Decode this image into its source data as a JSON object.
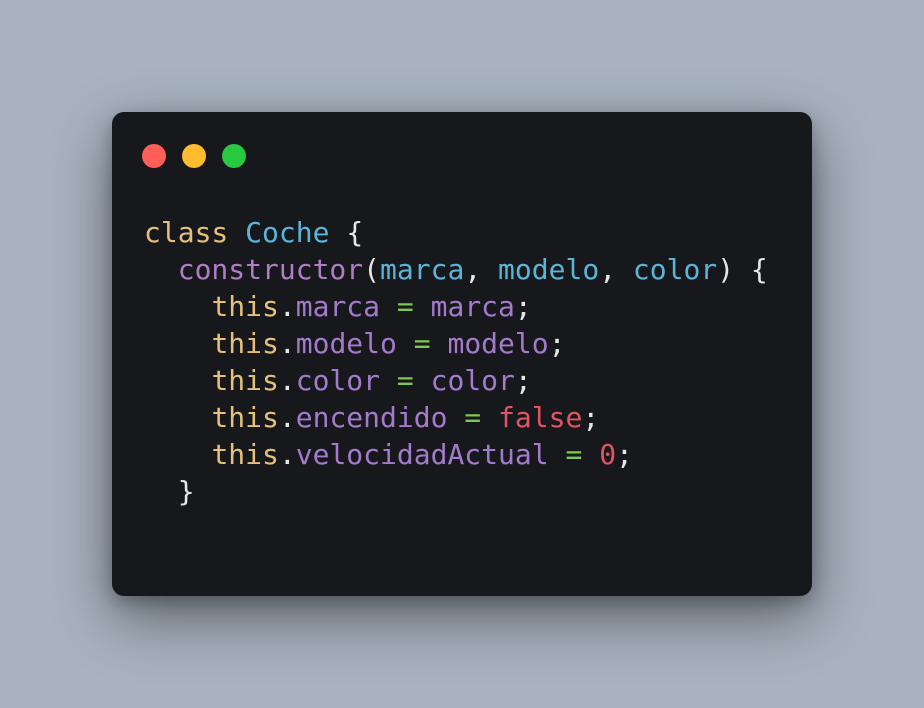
{
  "window": {
    "background": "#17181b",
    "page_background": "#a8b3bf",
    "controls": [
      {
        "name": "close",
        "color": "#ff5f57"
      },
      {
        "name": "minimize",
        "color": "#febc2e"
      },
      {
        "name": "maximize",
        "color": "#28c840"
      }
    ]
  },
  "syntax_colors": {
    "keyword": "#e5c07b",
    "class_name": "#5ab6d9",
    "method": "#b07cc6",
    "param": "#5ab6d9",
    "property": "#a37acc",
    "operator": "#7ec84f",
    "boolean": "#e05561",
    "number": "#e05561",
    "punct": "#e6e6e6"
  },
  "code": {
    "line1": {
      "kw": "class",
      "sp1": " ",
      "name": "Coche",
      "sp2": " ",
      "brace": "{"
    },
    "line2": {
      "indent": "  ",
      "method": "constructor",
      "paren_open": "(",
      "p1": "marca",
      "comma1": ", ",
      "p2": "modelo",
      "comma2": ", ",
      "p3": "color",
      "paren_close": ")",
      "sp": " ",
      "brace": "{"
    },
    "line3": {
      "indent": "    ",
      "this": "this",
      "dot": ".",
      "prop": "marca",
      "eq": " = ",
      "value": "marca",
      "semi": ";"
    },
    "line4": {
      "indent": "    ",
      "this": "this",
      "dot": ".",
      "prop": "modelo",
      "eq": " = ",
      "value": "modelo",
      "semi": ";"
    },
    "line5": {
      "indent": "    ",
      "this": "this",
      "dot": ".",
      "prop": "color",
      "eq": " = ",
      "value": "color",
      "semi": ";"
    },
    "line6": {
      "indent": "    ",
      "this": "this",
      "dot": ".",
      "prop": "encendido",
      "eq": " = ",
      "value": "false",
      "semi": ";"
    },
    "line7": {
      "indent": "    ",
      "this": "this",
      "dot": ".",
      "prop": "velocidadActual",
      "eq": " = ",
      "value": "0",
      "semi": ";"
    },
    "line8": {
      "indent": "  ",
      "brace": "}"
    }
  }
}
